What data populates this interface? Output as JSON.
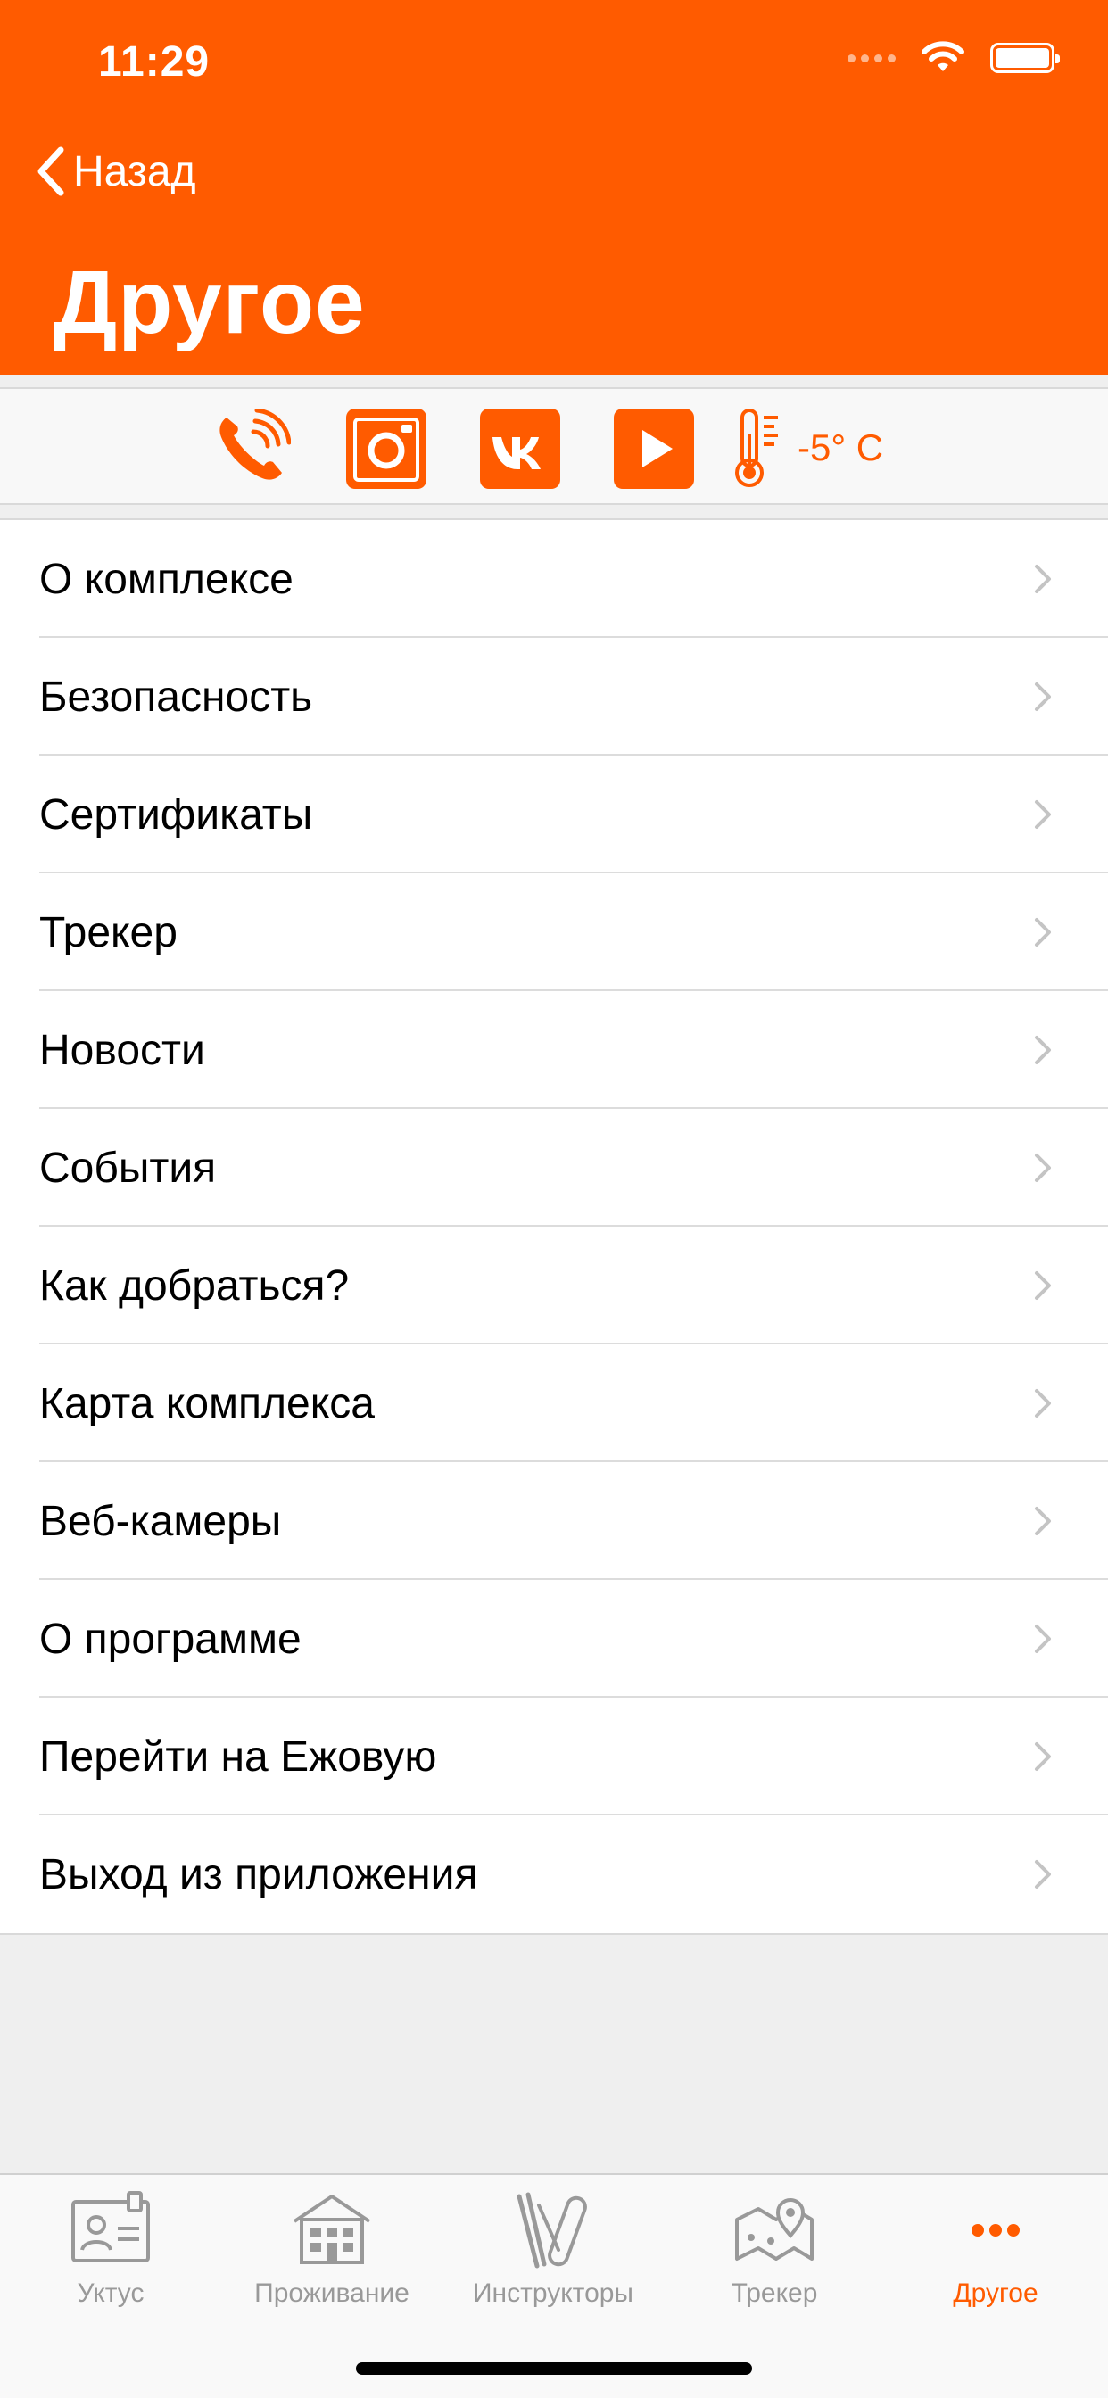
{
  "status": {
    "time": "11:29"
  },
  "nav": {
    "back_label": "Назад",
    "title": "Другое"
  },
  "quick": {
    "temperature": "-5° C"
  },
  "menu": [
    {
      "label": "О комплексе"
    },
    {
      "label": "Безопасность"
    },
    {
      "label": "Сертификаты"
    },
    {
      "label": "Трекер"
    },
    {
      "label": "Новости"
    },
    {
      "label": "События"
    },
    {
      "label": "Как добраться?"
    },
    {
      "label": "Карта комплекса"
    },
    {
      "label": "Веб-камеры"
    },
    {
      "label": "О программе"
    },
    {
      "label": "Перейти на Ежовую"
    },
    {
      "label": "Выход из приложения"
    }
  ],
  "tabs": [
    {
      "label": "Уктус",
      "icon": "id-card-icon"
    },
    {
      "label": "Проживание",
      "icon": "house-icon"
    },
    {
      "label": "Инструкторы",
      "icon": "ski-icon"
    },
    {
      "label": "Трекер",
      "icon": "map-pin-icon"
    },
    {
      "label": "Другое",
      "icon": "more-dots-icon",
      "active": true
    }
  ],
  "colors": {
    "accent": "#FF5B00",
    "tab_inactive": "#999999",
    "background": "#EFEFEF"
  }
}
